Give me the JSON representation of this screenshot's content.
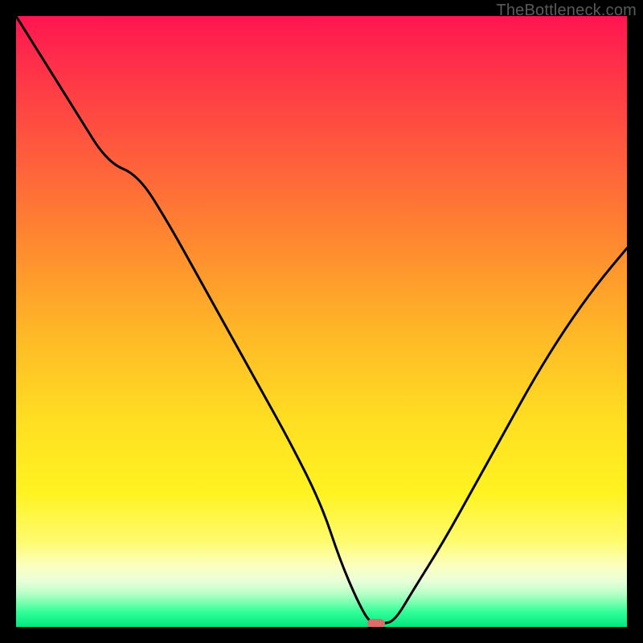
{
  "watermark": "TheBottleneck.com",
  "colors": {
    "frame_bg": "#000000",
    "watermark": "#5a5a5a",
    "curve_stroke": "#000000",
    "marker_fill": "#e06a6a",
    "gradient_top": "#ff1450",
    "gradient_bottom": "#00e87e"
  },
  "chart_data": {
    "type": "line",
    "title": "",
    "xlabel": "",
    "ylabel": "",
    "xlim": [
      0,
      100
    ],
    "ylim": [
      0,
      100
    ],
    "grid": false,
    "legend": false,
    "x": [
      0,
      5,
      10,
      15,
      20,
      25,
      30,
      35,
      40,
      45,
      50,
      53,
      56,
      58,
      60,
      62,
      65,
      70,
      75,
      80,
      85,
      90,
      95,
      100
    ],
    "y": [
      100,
      92,
      84,
      76,
      74,
      66,
      57,
      48,
      39,
      30,
      20,
      11,
      4,
      0.5,
      0.5,
      1,
      6,
      14,
      23,
      32,
      41,
      49,
      56,
      62
    ],
    "min_point": {
      "x": 59,
      "y": 0.5
    },
    "annotations": []
  }
}
